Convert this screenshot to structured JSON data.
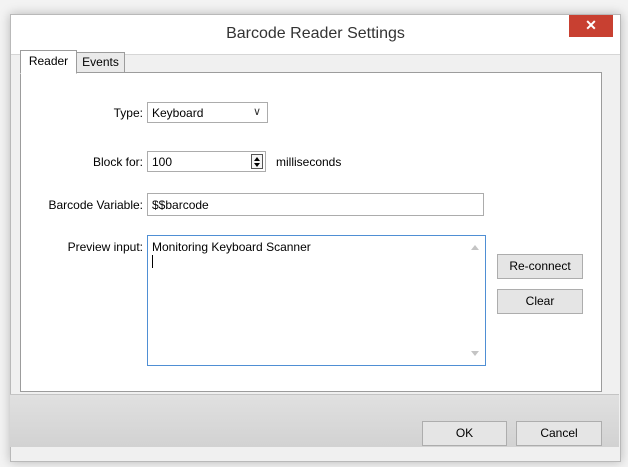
{
  "window": {
    "title": "Barcode Reader Settings",
    "close_glyph": "✕"
  },
  "tabs": [
    {
      "label": "Reader",
      "active": true
    },
    {
      "label": "Events",
      "active": false
    }
  ],
  "form": {
    "type_label": "Type:",
    "type_value": "Keyboard",
    "block_label": "Block for:",
    "block_value": "100",
    "block_unit": "milliseconds",
    "variable_label": "Barcode Variable:",
    "variable_value": "$$barcode",
    "preview_label": "Preview input:",
    "preview_value": "Monitoring Keyboard Scanner"
  },
  "buttons": {
    "reconnect": "Re-connect",
    "clear": "Clear",
    "ok": "OK",
    "cancel": "Cancel"
  },
  "colors": {
    "close_button": "#c84031",
    "focus_border": "#4f8fd4"
  }
}
